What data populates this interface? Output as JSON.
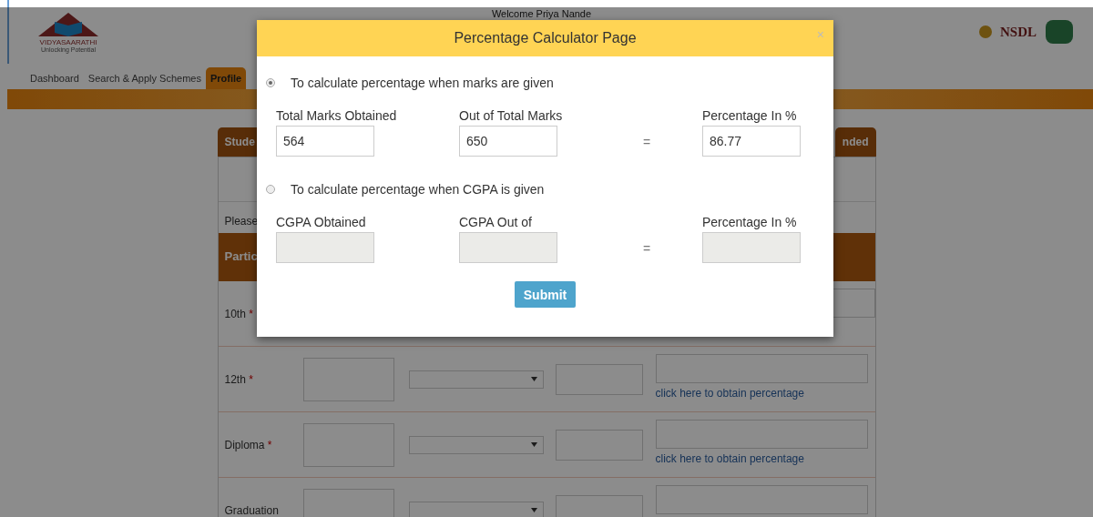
{
  "header": {
    "welcome": "Welcome  Priya Nande",
    "logo_text": "VIDYASAARATHI",
    "logo_tagline": "Unlocking Potential",
    "partner_logo": "NSDL"
  },
  "nav_tabs": [
    {
      "label": "Dashboard",
      "selected": false
    },
    {
      "label": "Search & Apply Schemes",
      "selected": false
    },
    {
      "label": "Profile",
      "selected": true
    }
  ],
  "card": {
    "tabs": [
      {
        "label": "Stude"
      },
      {
        "label": "nded"
      }
    ],
    "note": "Please",
    "table_header": "Partic",
    "rows": [
      {
        "label": "10th",
        "required_mark": "*",
        "kind": "covered"
      },
      {
        "label": "12th",
        "required_mark": "*",
        "link": "click here to obtain percentage"
      },
      {
        "label": "Diploma",
        "required_mark": "*",
        "link": "click here to obtain percentage"
      },
      {
        "label": "Graduation"
      }
    ]
  },
  "modal": {
    "title": "Percentage Calculator Page",
    "close": "×",
    "sections": [
      {
        "label": "To calculate percentage when marks are given",
        "selected": true,
        "equals": "=",
        "fields": [
          {
            "label": "Total Marks Obtained",
            "value": "564",
            "disabled": false
          },
          {
            "label": "Out of Total Marks",
            "value": "650",
            "disabled": false
          },
          {
            "label": "Percentage In %",
            "value": "86.77",
            "disabled": false
          }
        ]
      },
      {
        "label": "To calculate percentage when CGPA is given",
        "selected": false,
        "equals": "=",
        "fields": [
          {
            "label": "CGPA Obtained",
            "disabled": true
          },
          {
            "label": "CGPA Out of",
            "disabled": true
          },
          {
            "label": "Percentage In %",
            "disabled": true
          }
        ]
      }
    ],
    "submit": "Submit"
  }
}
